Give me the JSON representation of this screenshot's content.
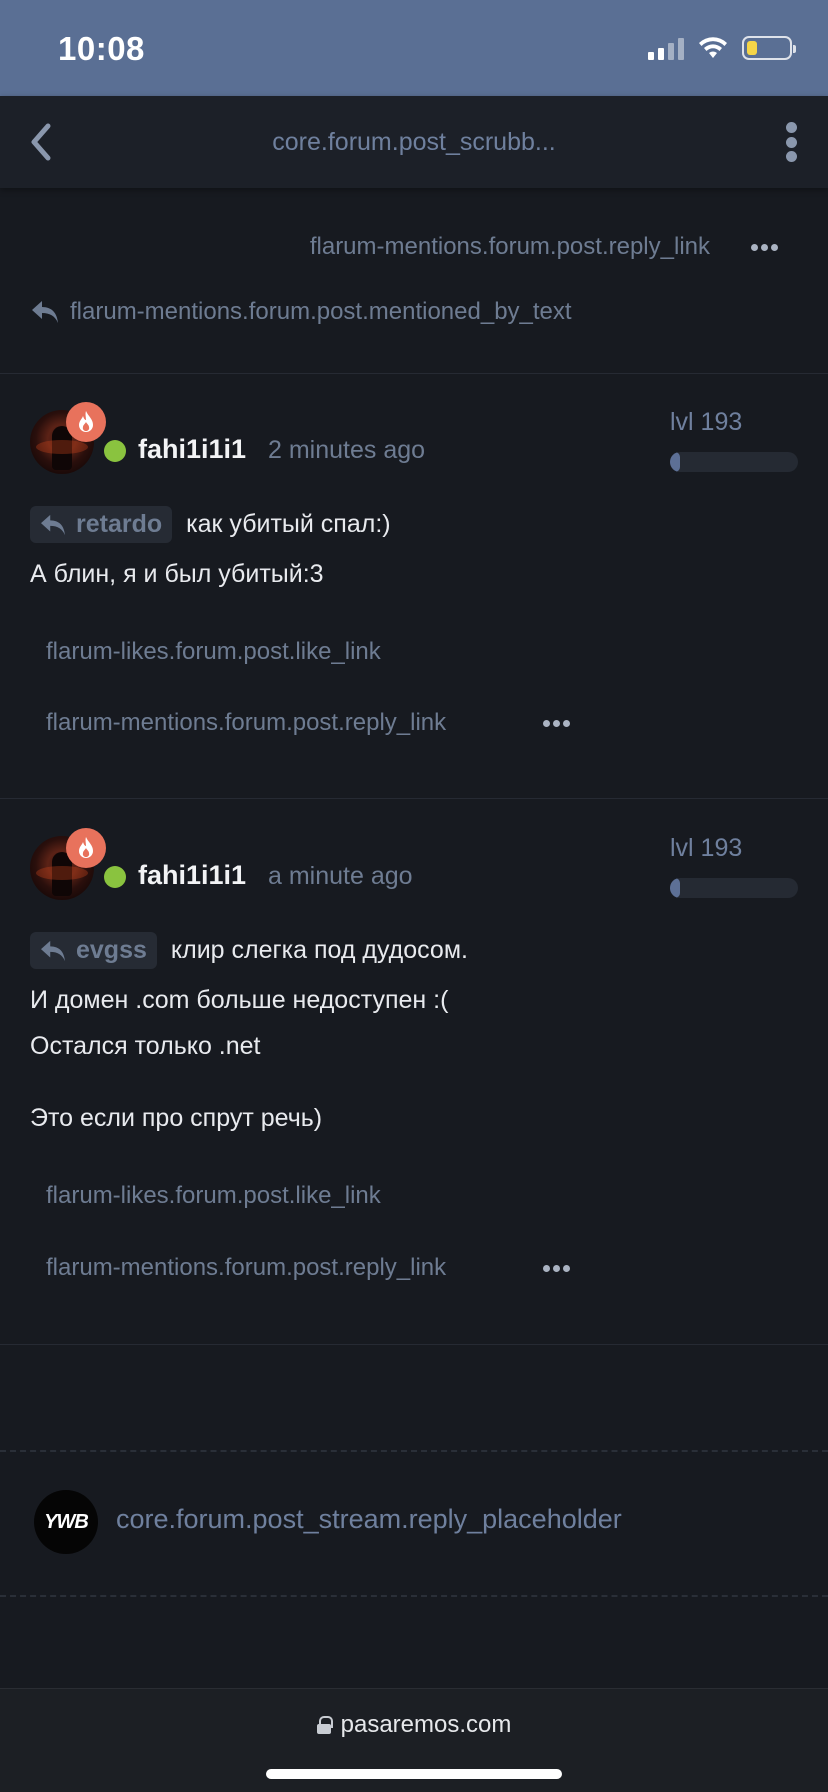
{
  "status_bar": {
    "time": "10:08"
  },
  "header": {
    "title": "core.forum.post_scrubb..."
  },
  "stub": {
    "reply_link": "flarum-mentions.forum.post.reply_link",
    "mentioned_by": "flarum-mentions.forum.post.mentioned_by_text"
  },
  "posts": [
    {
      "username": "fahi1i1i1",
      "time": "2 minutes ago",
      "level": "lvl 193",
      "level_progress": 0.06,
      "mention": "retardo",
      "lines": [
        "как убитый спал:)",
        "А блин, я и был убитый:3"
      ],
      "like_link": "flarum-likes.forum.post.like_link",
      "reply_link": "flarum-mentions.forum.post.reply_link"
    },
    {
      "username": "fahi1i1i1",
      "time": "a minute ago",
      "level": "lvl 193",
      "level_progress": 0.06,
      "mention": "evgss",
      "lines": [
        "клир слегка под дудосом.",
        "И домен .com больше недоступен :(",
        "Остался только .net",
        "Это если про спрут речь)"
      ],
      "like_link": "flarum-likes.forum.post.like_link",
      "reply_link": "flarum-mentions.forum.post.reply_link"
    }
  ],
  "composer": {
    "avatar_text": "YWB",
    "placeholder": "core.forum.post_stream.reply_placeholder"
  },
  "browser": {
    "url": "pasaremos.com"
  },
  "colors": {
    "accent": "#5a6f94",
    "online": "#8ac33f",
    "badge": "#e8725c"
  }
}
